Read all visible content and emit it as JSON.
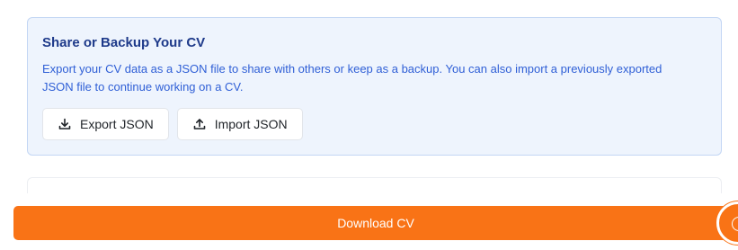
{
  "share_card": {
    "title": "Share or Backup Your CV",
    "description": "Export your CV data as a JSON file to share with others or keep as a backup. You can also import a previously exported JSON file to continue working on a CV.",
    "export_label": "Export JSON",
    "export_icon": "download-icon",
    "import_label": "Import JSON",
    "import_icon": "upload-icon"
  },
  "footer": {
    "download_label": "Download CV",
    "help_icon": "help-circle-icon"
  },
  "colors": {
    "accent": "#f97316",
    "card_background": "#eef4fd",
    "title": "#1e3a8a",
    "description": "#2f5fd6"
  }
}
